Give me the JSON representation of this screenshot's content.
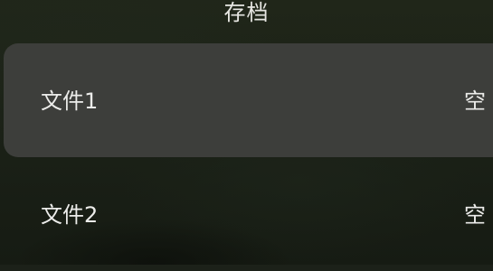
{
  "screen": {
    "title": "存档"
  },
  "save_slots": [
    {
      "name": "文件1",
      "status": "空",
      "selected": true
    },
    {
      "name": "文件2",
      "status": "空",
      "selected": false
    }
  ],
  "colors": {
    "background": "#1c2119",
    "selected_row": "#3d3e3b",
    "text": "#ececea"
  }
}
